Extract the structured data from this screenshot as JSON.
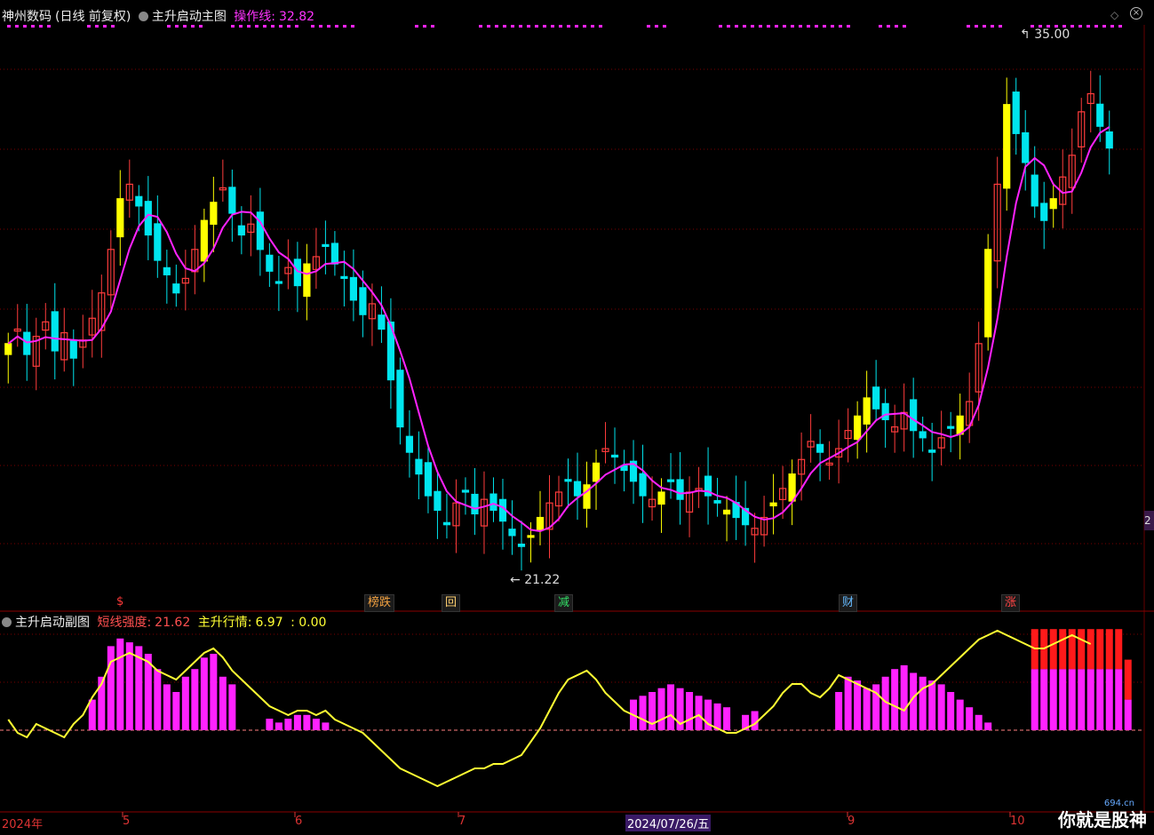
{
  "header": {
    "stock_name": "神州数码",
    "period": "(日线 前复权)",
    "indicator_main": "主升启动主图",
    "op_line_label": "操作线:",
    "op_line_value": "32.82"
  },
  "sub_header": {
    "indicator_sub": "主升启动副图",
    "short_label": "短线强度:",
    "short_value": "21.62",
    "main_label": "主升行情:",
    "main_value": "6.97",
    "extra": ": 0.00"
  },
  "annotations": {
    "high_label": "35.00",
    "low_label": "21.22",
    "right_badge": "2"
  },
  "events": [
    {
      "label": "$",
      "color": "#ff3a3a"
    },
    {
      "label": "榜跌",
      "color": "#f0a040"
    },
    {
      "label": "回",
      "color": "#ffd070"
    },
    {
      "label": "减",
      "color": "#33dd66"
    },
    {
      "label": "财",
      "color": "#66bbff"
    },
    {
      "label": "涨",
      "color": "#ff4444"
    }
  ],
  "x_axis": {
    "labels": [
      "2024年",
      "5",
      "6",
      "7",
      "2024/07/26/五",
      "9",
      "10"
    ]
  },
  "watermark": {
    "text": "你就是股神",
    "sub": "694.cn"
  },
  "colors": {
    "up": "#ff3c3c",
    "down": "#00e5ee",
    "boost": "#ffff00",
    "ma": "#ff22ff",
    "strength_line": "#ffff33",
    "bar_magenta": "#ff22ff",
    "bar_red": "#ff1a1a",
    "grid": "#7a0000"
  },
  "chart_data": {
    "type": "candlestick",
    "title": "神州数码 (日线 前复权)",
    "price_high": 35.0,
    "price_low": 21.22,
    "operation_line": 32.82,
    "ohlc_close_series": [
      27.2,
      27.6,
      26.9,
      27.4,
      27.8,
      27.0,
      27.5,
      26.8,
      27.3,
      27.9,
      28.6,
      29.8,
      31.2,
      31.6,
      31.0,
      30.2,
      29.5,
      29.1,
      28.6,
      29.0,
      29.8,
      30.6,
      31.1,
      31.5,
      30.8,
      30.2,
      30.5,
      29.8,
      29.2,
      28.9,
      29.3,
      28.8,
      29.4,
      29.6,
      29.9,
      29.4,
      29.0,
      28.4,
      28.0,
      28.3,
      27.6,
      26.2,
      24.9,
      24.2,
      23.6,
      23.0,
      22.6,
      22.2,
      22.8,
      23.1,
      22.5,
      22.9,
      22.6,
      22.3,
      21.9,
      21.6,
      21.9,
      22.4,
      22.8,
      23.1,
      23.4,
      23.0,
      23.3,
      23.9,
      24.3,
      24.1,
      23.7,
      23.4,
      23.0,
      22.9,
      23.1,
      23.4,
      22.9,
      23.1,
      23.2,
      23.0,
      22.8,
      22.6,
      22.4,
      22.2,
      22.1,
      22.4,
      22.8,
      23.2,
      23.6,
      24.0,
      24.5,
      24.2,
      23.9,
      24.3,
      24.8,
      25.2,
      25.7,
      25.4,
      25.1,
      24.9,
      25.3,
      24.8,
      24.6,
      24.2,
      24.6,
      24.9,
      25.2,
      25.6,
      27.2,
      29.8,
      31.6,
      33.8,
      33.0,
      32.2,
      31.0,
      30.6,
      31.2,
      31.8,
      32.4,
      33.6,
      34.1,
      33.2,
      32.6
    ],
    "ylabel": "",
    "sub_chart": {
      "title": "主升启动副图",
      "short_strength": 21.62,
      "main_trend": 6.97,
      "extra": 0.0,
      "strength_series": [
        20,
        17,
        16,
        19,
        18,
        17,
        16,
        19,
        21,
        25,
        28,
        33,
        34,
        35,
        34,
        33,
        31,
        30,
        29,
        31,
        33,
        35,
        36,
        34,
        31,
        29,
        27,
        25,
        23,
        22,
        21,
        22,
        22,
        21,
        22,
        20,
        19,
        18,
        17,
        15,
        13,
        11,
        9,
        8,
        7,
        6,
        5,
        6,
        7,
        8,
        9,
        9,
        10,
        10,
        11,
        12,
        15,
        18,
        22,
        26,
        29,
        30,
        31,
        29,
        26,
        24,
        22,
        21,
        20,
        19,
        20,
        21,
        19,
        20,
        21,
        19,
        18,
        17,
        17,
        18,
        19,
        21,
        23,
        26,
        28,
        28,
        26,
        25,
        27,
        30,
        29,
        28,
        27,
        26,
        24,
        23,
        22,
        25,
        27,
        28,
        30,
        32,
        34,
        36,
        38,
        39,
        40,
        39,
        38,
        37,
        36,
        36,
        37,
        38,
        39,
        38,
        37
      ],
      "magenta_bars": [
        0,
        0,
        0,
        0,
        0,
        0,
        0,
        0,
        0,
        8,
        14,
        22,
        24,
        23,
        22,
        20,
        16,
        12,
        10,
        14,
        16,
        19,
        20,
        14,
        12,
        0,
        0,
        0,
        3,
        2,
        3,
        4,
        4,
        3,
        2,
        0,
        0,
        0,
        0,
        0,
        0,
        0,
        0,
        0,
        0,
        0,
        0,
        0,
        0,
        0,
        0,
        0,
        0,
        0,
        0,
        0,
        0,
        0,
        0,
        0,
        0,
        0,
        0,
        0,
        0,
        0,
        0,
        8,
        9,
        10,
        11,
        12,
        11,
        10,
        9,
        8,
        7,
        6,
        0,
        4,
        5,
        0,
        0,
        0,
        0,
        0,
        0,
        0,
        0,
        10,
        14,
        13,
        11,
        12,
        14,
        16,
        17,
        15,
        14,
        13,
        12,
        10,
        8,
        6,
        4,
        2,
        0,
        0,
        0,
        0,
        16,
        16,
        16,
        16,
        16,
        16,
        16,
        16,
        16,
        16,
        8
      ]
    }
  }
}
